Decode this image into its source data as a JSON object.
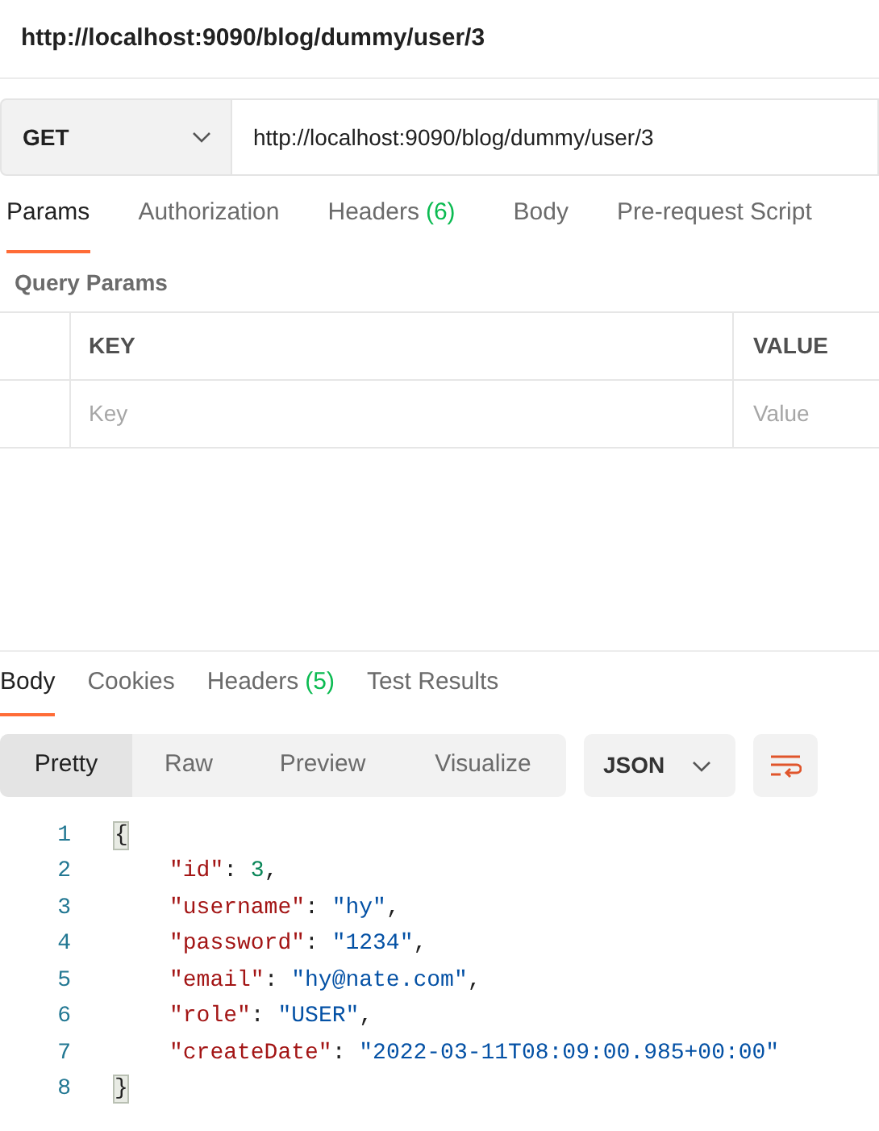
{
  "title": "http://localhost:9090/blog/dummy/user/3",
  "request": {
    "method": "GET",
    "url": "http://localhost:9090/blog/dummy/user/3"
  },
  "request_tabs": [
    {
      "label": "Params",
      "selected": true
    },
    {
      "label": "Authorization",
      "selected": false
    },
    {
      "label": "Headers",
      "count": "(6)",
      "selected": false
    },
    {
      "label": "Body",
      "selected": false
    },
    {
      "label": "Pre-request Script",
      "selected": false
    }
  ],
  "query_params": {
    "heading": "Query Params",
    "columns": [
      "KEY",
      "VALUE"
    ],
    "placeholders": [
      "Key",
      "Value"
    ]
  },
  "response_tabs": [
    {
      "label": "Body",
      "selected": true
    },
    {
      "label": "Cookies",
      "selected": false
    },
    {
      "label": "Headers",
      "count": "(5)",
      "selected": false
    },
    {
      "label": "Test Results",
      "selected": false
    }
  ],
  "view_modes": [
    {
      "label": "Pretty",
      "selected": true
    },
    {
      "label": "Raw",
      "selected": false
    },
    {
      "label": "Preview",
      "selected": false
    },
    {
      "label": "Visualize",
      "selected": false
    }
  ],
  "format": "JSON",
  "code_lines": [
    {
      "number": "1",
      "kind": "brace",
      "tokens": [
        {
          "kind": "brace",
          "text": "{"
        }
      ]
    },
    {
      "number": "2",
      "kind": "member",
      "tokens": [
        {
          "kind": "key",
          "text": "\"id\""
        },
        {
          "kind": "punct",
          "text": ": "
        },
        {
          "kind": "number",
          "text": "3"
        },
        {
          "kind": "punct",
          "text": ","
        }
      ]
    },
    {
      "number": "3",
      "kind": "member",
      "tokens": [
        {
          "kind": "key",
          "text": "\"username\""
        },
        {
          "kind": "punct",
          "text": ": "
        },
        {
          "kind": "string",
          "text": "\"hy\""
        },
        {
          "kind": "punct",
          "text": ","
        }
      ]
    },
    {
      "number": "4",
      "kind": "member",
      "tokens": [
        {
          "kind": "key",
          "text": "\"password\""
        },
        {
          "kind": "punct",
          "text": ": "
        },
        {
          "kind": "string",
          "text": "\"1234\""
        },
        {
          "kind": "punct",
          "text": ","
        }
      ]
    },
    {
      "number": "5",
      "kind": "member",
      "tokens": [
        {
          "kind": "key",
          "text": "\"email\""
        },
        {
          "kind": "punct",
          "text": ": "
        },
        {
          "kind": "string",
          "text": "\"hy@nate.com\""
        },
        {
          "kind": "punct",
          "text": ","
        }
      ]
    },
    {
      "number": "6",
      "kind": "member",
      "tokens": [
        {
          "kind": "key",
          "text": "\"role\""
        },
        {
          "kind": "punct",
          "text": ": "
        },
        {
          "kind": "string",
          "text": "\"USER\""
        },
        {
          "kind": "punct",
          "text": ","
        }
      ]
    },
    {
      "number": "7",
      "kind": "member",
      "tokens": [
        {
          "kind": "key",
          "text": "\"createDate\""
        },
        {
          "kind": "punct",
          "text": ": "
        },
        {
          "kind": "string",
          "text": "\"2022-03-11T08:09:00.985+00:00\""
        }
      ]
    },
    {
      "number": "8",
      "kind": "brace",
      "tokens": [
        {
          "kind": "brace",
          "text": "}"
        }
      ]
    }
  ]
}
